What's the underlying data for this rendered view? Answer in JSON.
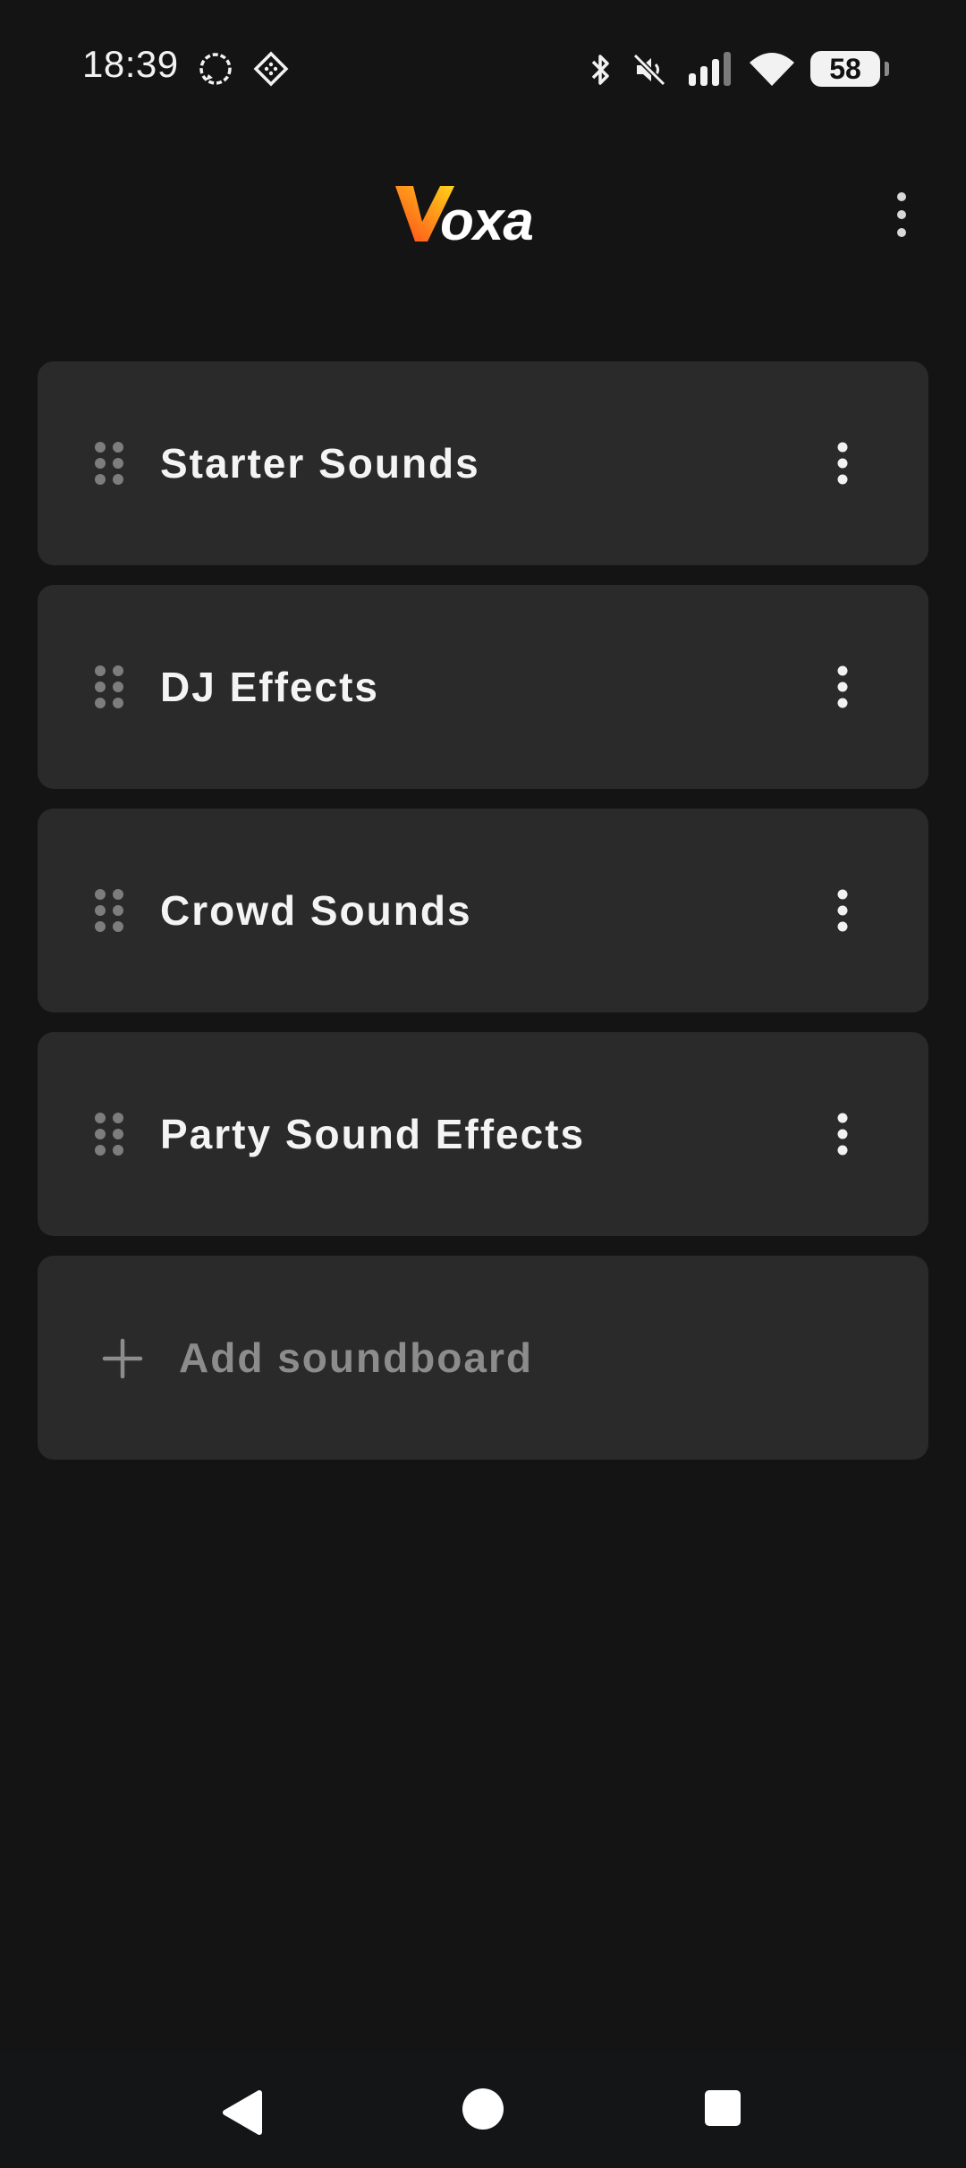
{
  "status_bar": {
    "time": "18:39",
    "battery_level": "58",
    "icons": [
      "signal-messenger-icon",
      "grid-app-icon",
      "bluetooth-icon",
      "muted-speaker-icon",
      "cellular-signal-icon",
      "wifi-icon",
      "battery-icon"
    ]
  },
  "header": {
    "logo_text": "Voxa",
    "overflow_icon": "more-vertical-icon"
  },
  "soundboards": [
    {
      "title": "Starter Sounds"
    },
    {
      "title": "DJ Effects"
    },
    {
      "title": "Crowd Sounds"
    },
    {
      "title": "Party Sound Effects"
    }
  ],
  "add_soundboard": {
    "label": "Add soundboard",
    "icon": "plus-icon"
  },
  "nav_bar": {
    "back_icon": "back-triangle-icon",
    "home_icon": "home-circle-icon",
    "recents_icon": "recents-square-icon"
  },
  "colors": {
    "background": "#141414",
    "card": "#2a2a2b",
    "logo_gradient_start": "#ff5a1f",
    "logo_gradient_end": "#ffd21a",
    "muted_text": "#8c8c8c"
  }
}
